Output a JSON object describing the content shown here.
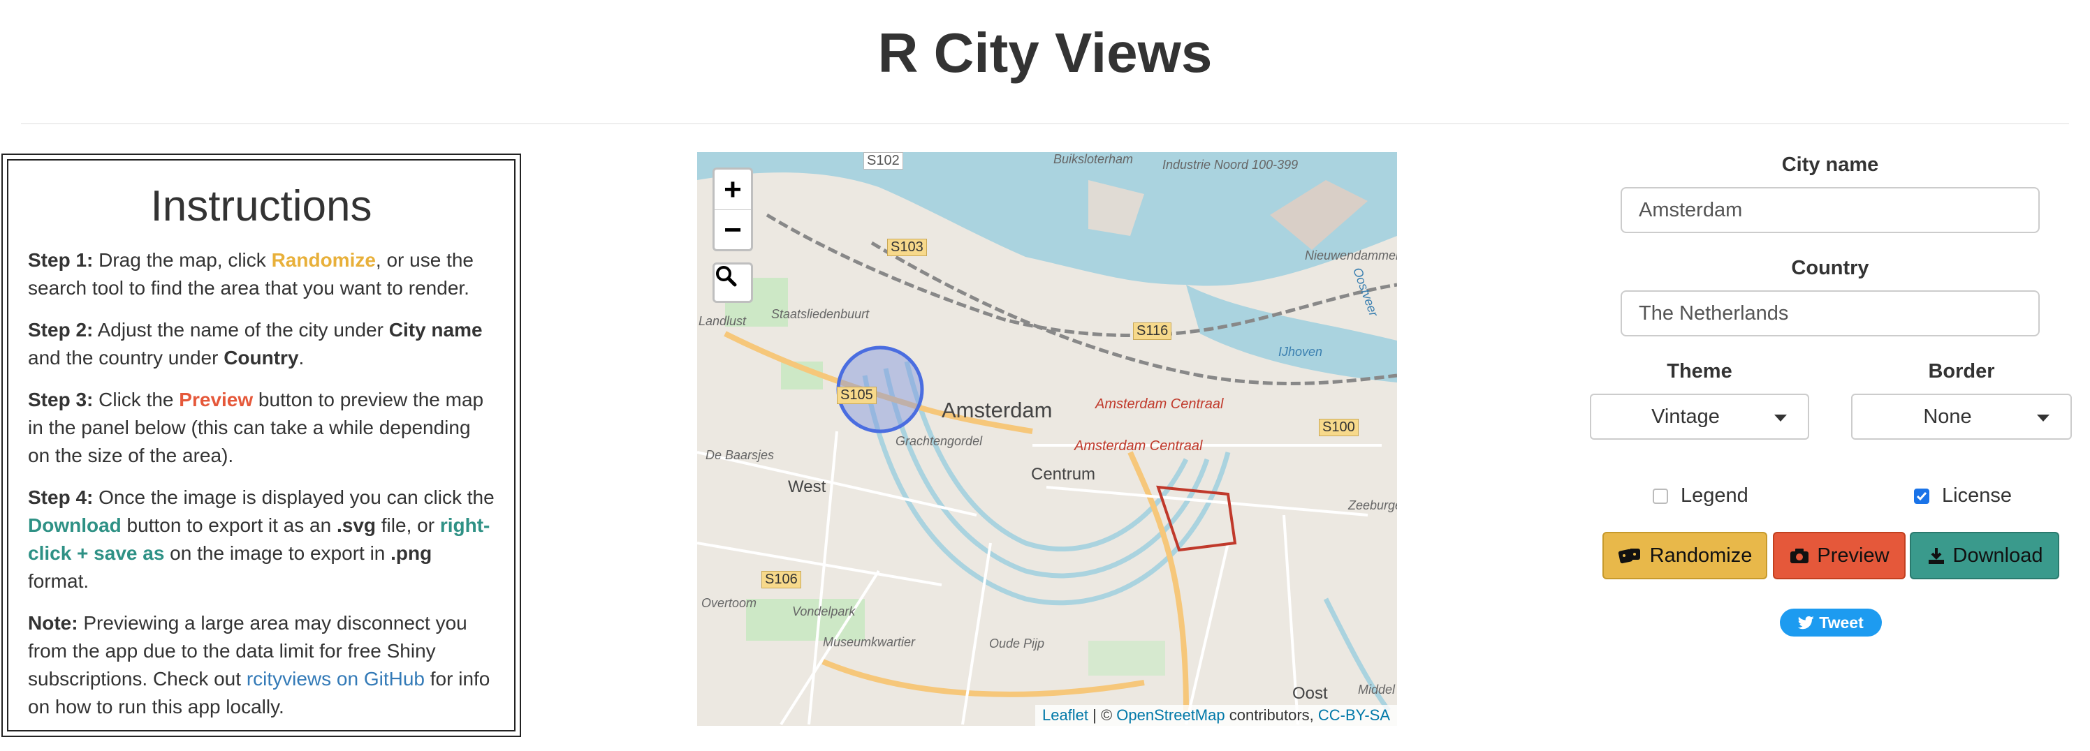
{
  "app": {
    "title": "R City Views"
  },
  "instructions": {
    "heading": "Instructions",
    "step1": {
      "label": "Step 1:",
      "a": " Drag the map, click ",
      "randomize": "Randomize",
      "b": ", or use the search tool to find the area that you want to render."
    },
    "step2": {
      "label": "Step 2:",
      "a": " Adjust the name of the city under ",
      "city": "City name",
      "b": " and the country under ",
      "country": "Country",
      "c": "."
    },
    "step3": {
      "label": "Step 3:",
      "a": " Click the ",
      "preview": "Preview",
      "b": " button to preview the map in the panel below (this can take a while depending on the size of the area)."
    },
    "step4": {
      "label": "Step 4:",
      "a": " Once the image is displayed you can click the ",
      "download": "Download",
      "b": " button to export it as an ",
      "svg": ".svg",
      "c": " file, or ",
      "rightclick": "right-click + save as",
      "d": " on the image to export in ",
      "png": ".png",
      "e": " format."
    },
    "note": {
      "label": "Note:",
      "a": " Previewing a large area may disconnect you from the app due to the data limit for free Shiny subscriptions. Check out ",
      "link": "rcityviews on GitHub",
      "b": " for info on how to run this app locally."
    }
  },
  "map": {
    "zoom_in": "+",
    "zoom_out": "−",
    "search_icon": "magnifier-icon",
    "labels": [
      "S102",
      "S103",
      "S116",
      "S105",
      "S100",
      "S106",
      "Amsterdam",
      "Centrum",
      "West",
      "Landlust",
      "De Baarsjes",
      "Grachtengordel",
      "Staatsliedenbuurt",
      "Vondelpark",
      "Museumkwartier",
      "Oude Pijp",
      "Oost",
      "Amsterdam Centraal",
      "Buiksloterham",
      "Industrie Noord 100-399",
      "Nieuwendammerhe",
      "Oostveer",
      "IJhoven",
      "Zeeburge",
      "Overtoom",
      "Middel"
    ],
    "attribution": {
      "leaflet": "Leaflet",
      "sep": " | © ",
      "osm": "OpenStreetMap",
      "mid": " contributors, ",
      "license": "CC-BY-SA"
    }
  },
  "controls": {
    "city_label": "City name",
    "city_value": "Amsterdam",
    "country_label": "Country",
    "country_value": "The Netherlands",
    "theme_label": "Theme",
    "theme_value": "Vintage",
    "border_label": "Border",
    "border_value": "None",
    "legend_label": "Legend",
    "legend_checked": false,
    "license_label": "License",
    "license_checked": true,
    "randomize_label": "Randomize",
    "preview_label": "Preview",
    "download_label": "Download",
    "tweet_label": "Tweet"
  },
  "colors": {
    "randomize": "#e8b84a",
    "preview": "#e5583a",
    "download": "#3a9a8c",
    "tweet": "#1d9bf0",
    "checkbox": "#1a73e8"
  }
}
